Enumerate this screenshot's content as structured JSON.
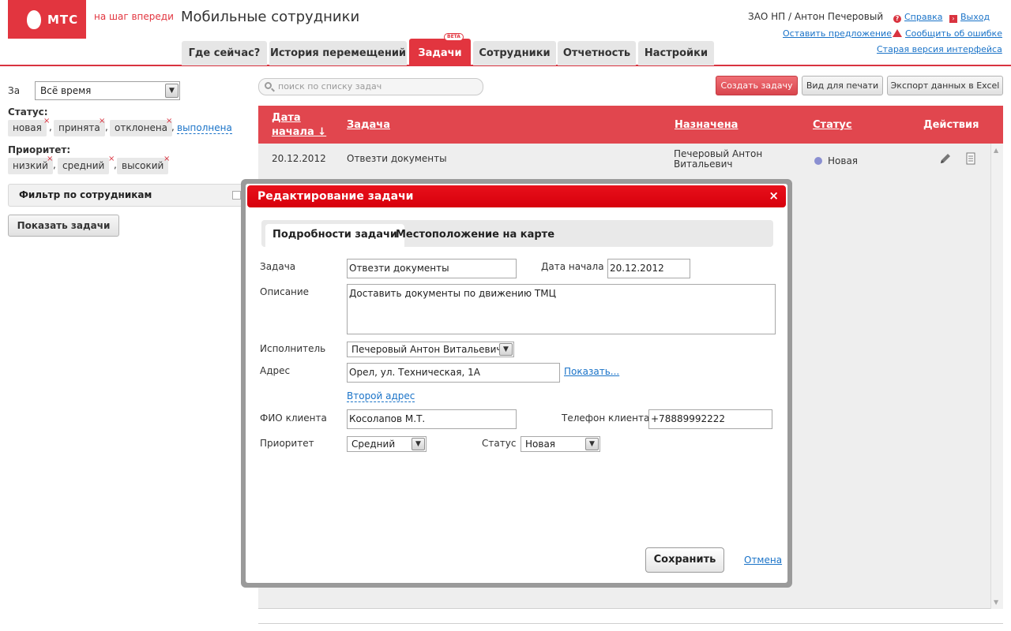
{
  "header": {
    "logo_text": "МТС",
    "slogan": "на шаг впереди",
    "title": "Мобильные сотрудники",
    "user": "ЗАО НП / Антон Печеровый",
    "links": {
      "help": "Справка",
      "logout": "Выход",
      "feedback": "Оставить предложение",
      "report_error": "Сообщить об ошибке",
      "old_version": "Старая версия интерфейса"
    },
    "tabs": [
      {
        "label": "Где сейчас?",
        "active": false
      },
      {
        "label": "История перемещений",
        "active": false
      },
      {
        "label": "Задачи",
        "active": true,
        "badge": "BETA"
      },
      {
        "label": "Сотрудники",
        "active": false
      },
      {
        "label": "Отчетность",
        "active": false
      },
      {
        "label": "Настройки",
        "active": false
      }
    ]
  },
  "sidebar": {
    "period_label": "За",
    "period_value": "Всё время",
    "status_label": "Статус:",
    "status_chips": [
      "новая",
      "принята",
      "отклонена"
    ],
    "status_link": "выполнена",
    "priority_label": "Приоритет:",
    "priority_chips": [
      "низкий",
      "средний",
      "высокий"
    ],
    "staff_filter": "Фильтр по сотрудникам",
    "show_button": "Показать задачи"
  },
  "toolbar": {
    "search_placeholder": "поиск по списку задач",
    "create_task": "Создать задачу",
    "print_view": "Вид для печати",
    "export_excel": "Экспорт данных в Excel"
  },
  "table": {
    "columns": {
      "start_date_line1": "Дата",
      "start_date_line2": "начала ↓",
      "task": "Задача",
      "assigned": "Назначена",
      "status": "Статус",
      "actions": "Действия"
    },
    "rows": [
      {
        "date": "20.12.2012",
        "task": "Отвезти документы",
        "assigned_line1": "Печеровый Антон",
        "assigned_line2": "Витальевич",
        "status": "Новая",
        "status_color": "#8a8fd1"
      }
    ]
  },
  "modal": {
    "title": "Редактирование задачи",
    "tabs": [
      "Подробности задачи",
      "Местоположение на карте"
    ],
    "fields": {
      "task_label": "Задача",
      "task_value": "Отвезти документы",
      "start_date_label": "Дата начала",
      "start_date_value": "20.12.2012",
      "description_label": "Описание",
      "description_value": "Доставить документы по движению ТМЦ",
      "executor_label": "Исполнитель",
      "executor_value": "Печеровый Антон Витальевич",
      "address_label": "Адрес",
      "address_value": "Орел, ул. Техническая, 1А",
      "show_link": "Показать...",
      "second_address_link": "Второй адрес",
      "client_name_label": "ФИО клиента",
      "client_name_value": "Косолапов М.Т.",
      "client_phone_label": "Телефон клиента",
      "client_phone_value": "+78889992222",
      "priority_label": "Приоритет",
      "priority_value": "Средний",
      "status_label": "Статус",
      "status_value": "Новая"
    },
    "save": "Сохранить",
    "cancel": "Отмена"
  },
  "colors": {
    "brand_red": "#e2353f",
    "modal_red": "#e8101b",
    "link_blue": "#1a73c8"
  }
}
